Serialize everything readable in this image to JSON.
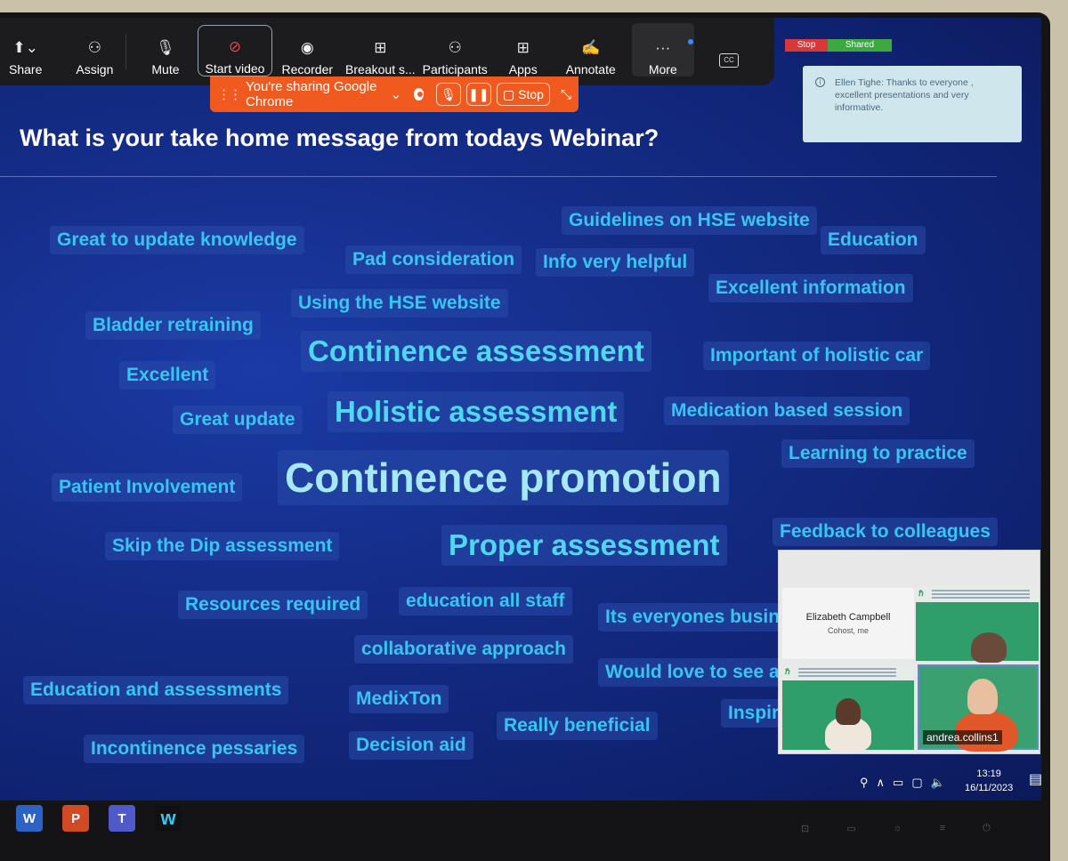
{
  "toolbar": {
    "items": [
      {
        "label": "Share",
        "icon": "share-screen-icon"
      },
      {
        "label": "Assign",
        "icon": "assign-person-icon"
      },
      {
        "label": "Mute",
        "icon": "microphone-icon"
      },
      {
        "label": "Start video",
        "icon": "video-off-icon"
      },
      {
        "label": "Recorder",
        "icon": "record-icon"
      },
      {
        "label": "Breakout s...",
        "icon": "breakout-rooms-icon"
      },
      {
        "label": "Participants",
        "icon": "participants-icon"
      },
      {
        "label": "Apps",
        "icon": "apps-icon"
      },
      {
        "label": "Annotate",
        "icon": "annotate-icon"
      },
      {
        "label": "More",
        "icon": "more-icon"
      }
    ],
    "cc_label": "CC"
  },
  "share_bar": {
    "text": "You're sharing Google Chrome",
    "stop_label": "Stop"
  },
  "indicators": {
    "stop": "Stop",
    "shared": "Shared"
  },
  "chat_toast": {
    "text": "Ellen Tighe: Thanks to everyone , excellent presentations and very informative."
  },
  "slide": {
    "title": "What is your take home message from todays Webinar?",
    "words": [
      {
        "text": "Great to update knowledge",
        "size": "s"
      },
      {
        "text": "Pad consideration",
        "size": "s"
      },
      {
        "text": "Guidelines on HSE website",
        "size": "s"
      },
      {
        "text": "Info very helpful",
        "size": "s"
      },
      {
        "text": "Education",
        "size": "s"
      },
      {
        "text": "Excellent information",
        "size": "s"
      },
      {
        "text": "Using the HSE website",
        "size": "s"
      },
      {
        "text": "Bladder retraining",
        "size": "s"
      },
      {
        "text": "Continence assessment",
        "size": "m"
      },
      {
        "text": "Important of holistic car",
        "size": "s"
      },
      {
        "text": "Excellent",
        "size": "s"
      },
      {
        "text": "Great update",
        "size": "s"
      },
      {
        "text": "Holistic assessment",
        "size": "m"
      },
      {
        "text": "Medication based session",
        "size": "s"
      },
      {
        "text": "Learning to practice",
        "size": "s"
      },
      {
        "text": "Patient Involvement",
        "size": "s"
      },
      {
        "text": "Continence promotion",
        "size": "xl"
      },
      {
        "text": "Skip the Dip assessment",
        "size": "s"
      },
      {
        "text": "Proper assessment",
        "size": "m"
      },
      {
        "text": "Feedback to colleagues",
        "size": "s"
      },
      {
        "text": "Resources required",
        "size": "s"
      },
      {
        "text": "education all staff",
        "size": "s"
      },
      {
        "text": "Its everyones busin",
        "size": "s"
      },
      {
        "text": "collaborative approach",
        "size": "s"
      },
      {
        "text": "Education and assessments",
        "size": "s"
      },
      {
        "text": "MedixTon",
        "size": "s"
      },
      {
        "text": "Would love to see a",
        "size": "s"
      },
      {
        "text": "Really beneficial",
        "size": "s"
      },
      {
        "text": "Inspir",
        "size": "s"
      },
      {
        "text": "Incontinence pessaries",
        "size": "s"
      },
      {
        "text": "Decision aid",
        "size": "s"
      }
    ]
  },
  "video_panel": {
    "name_tile": {
      "name": "Elizabeth Campbell",
      "role": "Cohost, me"
    },
    "active_speaker": "andrea.collins1"
  },
  "system_tray": {
    "time": "13:19",
    "date": "16/11/2023"
  },
  "taskbar_apps": [
    {
      "name": "Word",
      "glyph": "W"
    },
    {
      "name": "PowerPoint",
      "glyph": "P"
    },
    {
      "name": "Teams",
      "glyph": "T"
    },
    {
      "name": "Webex",
      "glyph": "w"
    }
  ]
}
